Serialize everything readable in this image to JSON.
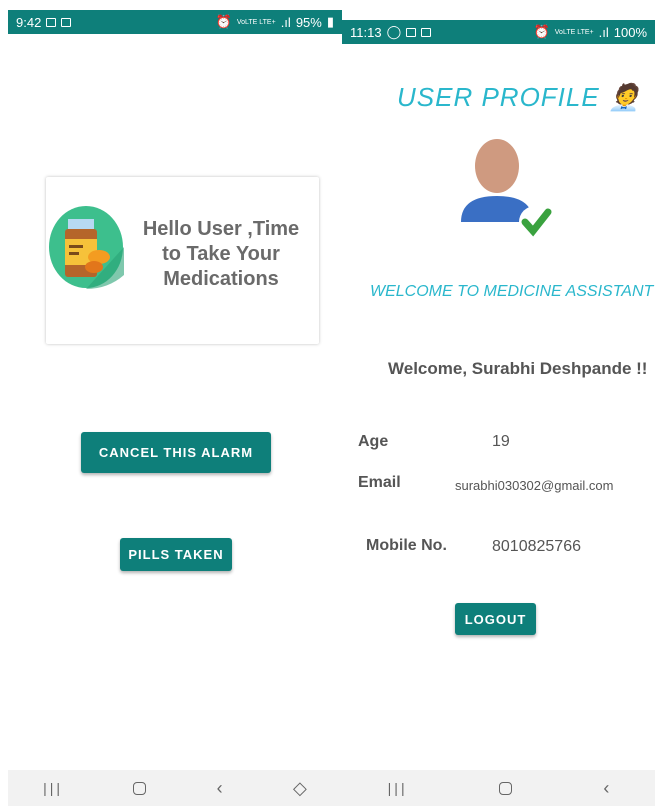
{
  "left": {
    "status_time": "9:42",
    "status_battery": "95%",
    "status_net": "VoLTE LTE+",
    "card_text": "Hello User ,Time to Take Your Medications",
    "cancel_button": "CANCEL THIS ALARM",
    "pills_button": "PILLS TAKEN"
  },
  "right": {
    "status_time": "11:13",
    "status_battery": "100%",
    "status_net": "VoLTE LTE+",
    "title": "USER PROFILE",
    "title_emoji": "🧑‍💼",
    "welcome_app": "WELCOME TO MEDICINE ASSISTANT",
    "welcome_user": "Welcome, Surabhi Deshpande !!",
    "age_label": "Age",
    "age_value": "19",
    "email_label": "Email",
    "email_value": "surabhi030302@gmail.com",
    "mobile_label": "Mobile No.",
    "mobile_value": "8010825766",
    "logout_button": "LOGOUT"
  },
  "colors": {
    "accent": "#0e7f7a",
    "title": "#2ab7cc",
    "text": "#555555"
  },
  "icons": [
    "photo-icon",
    "laptop-icon",
    "whatsapp-icon",
    "alarm-icon",
    "signal-icon",
    "battery-icon",
    "medicine-bottle-icon",
    "user-avatar-icon",
    "check-icon"
  ]
}
